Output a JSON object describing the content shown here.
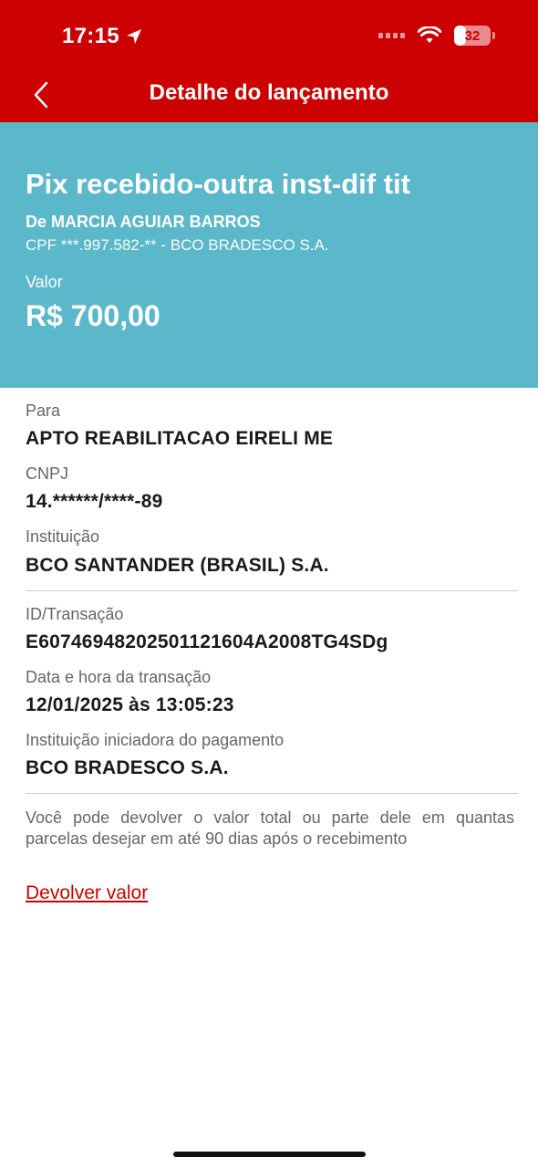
{
  "status_bar": {
    "time": "17:15",
    "battery": "32",
    "battery_fraction": 0.32
  },
  "nav": {
    "title": "Detalhe do lançamento"
  },
  "hero": {
    "title": "Pix recebido-outra inst-dif tit",
    "from": "De MARCIA AGUIAR BARROS",
    "document": "CPF ***.997.582-** - BCO BRADESCO S.A.",
    "value_label": "Valor",
    "value": "R$ 700,00"
  },
  "recipient": {
    "to_label": "Para",
    "to_value": "APTO REABILITACAO EIRELI ME",
    "cnpj_label": "CNPJ",
    "cnpj_value": "14.******/****-89",
    "institution_label": "Instituição",
    "institution_value": "BCO SANTANDER (BRASIL) S.A."
  },
  "transaction": {
    "id_label": "ID/Transação",
    "id_value": "E60746948202501121604A2008TG4SDg",
    "datetime_label": "Data e hora da transação",
    "datetime_value": "12/01/2025 às 13:05:23",
    "initiator_label": "Instituição iniciadora do pagamento",
    "initiator_value": "BCO BRADESCO S.A."
  },
  "info": {
    "text": "Você pode devolver o valor total ou parte dele em quantas parcelas desejar em até 90 dias após o recebimento",
    "refund_link": "Devolver valor"
  },
  "colors": {
    "header": "#cc0000",
    "hero": "#5bb8ca",
    "link": "#cc0000"
  }
}
